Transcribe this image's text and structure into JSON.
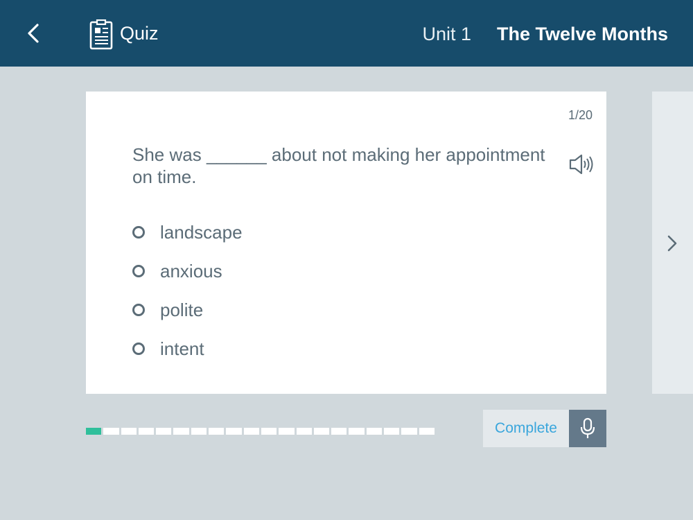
{
  "header": {
    "back_icon": "chevron-left-icon",
    "quiz_icon": "clipboard-icon",
    "section_label": "Quiz",
    "unit_label": "Unit 1",
    "title": "The Twelve Months"
  },
  "question": {
    "counter": "1/20",
    "text": "She was ______ about not making her appointment on time.",
    "audio_icon": "speaker-icon",
    "options": [
      {
        "label": "landscape"
      },
      {
        "label": "anxious"
      },
      {
        "label": "polite"
      },
      {
        "label": "intent"
      }
    ]
  },
  "navigation": {
    "next_icon": "chevron-right-icon"
  },
  "progress": {
    "current": 1,
    "total": 20
  },
  "footer": {
    "complete_label": "Complete",
    "mic_icon": "microphone-icon"
  },
  "colors": {
    "header_bg": "#174c6b",
    "page_bg": "#d0d8dc",
    "progress_active": "#2fbf9b",
    "complete_text": "#3aa6dc",
    "mic_bg": "#64798a"
  }
}
